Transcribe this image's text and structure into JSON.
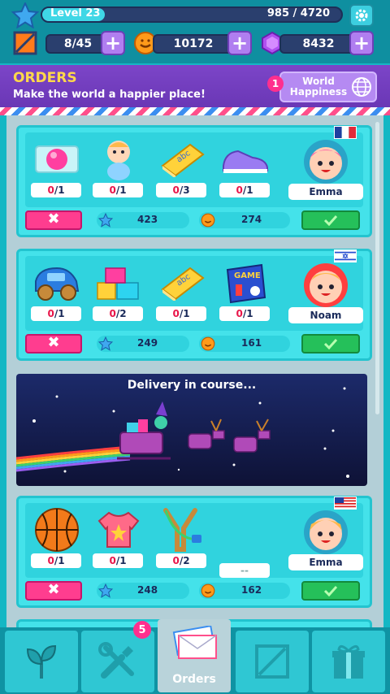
{
  "player": {
    "level_label": "Level 23",
    "xp_text": "985 / 4720",
    "xp_fraction": 0.209
  },
  "resources": {
    "boxes": "8/45",
    "coins": "10172",
    "gems": "8432"
  },
  "orders_header": {
    "title": "ORDERS",
    "subtitle": "Make the world a happier place!",
    "world_happiness_label": "World Happiness",
    "world_happiness_badge": "1"
  },
  "orders": [
    {
      "client": "Emma",
      "flag": "france",
      "items": [
        {
          "icon": "candy-icon",
          "done": "0",
          "total": "/1"
        },
        {
          "icon": "baby-doll-icon",
          "done": "0",
          "total": "/1"
        },
        {
          "icon": "abc-book-icon",
          "done": "0",
          "total": "/3"
        },
        {
          "icon": "sneakers-icon",
          "done": "0",
          "total": "/1"
        }
      ],
      "reward_xp": "423",
      "reward_coins": "274"
    },
    {
      "client": "Noam",
      "flag": "israel",
      "items": [
        {
          "icon": "toy-car-icon",
          "done": "0",
          "total": "/1"
        },
        {
          "icon": "building-blocks-icon",
          "done": "0",
          "total": "/2"
        },
        {
          "icon": "abc-book-icon",
          "done": "0",
          "total": "/1"
        },
        {
          "icon": "board-game-icon",
          "done": "0",
          "total": "/1"
        }
      ],
      "reward_xp": "249",
      "reward_coins": "161"
    },
    {
      "client": "Emma",
      "flag": "usa",
      "items": [
        {
          "icon": "basketball-icon",
          "done": "0",
          "total": "/1"
        },
        {
          "icon": "tshirt-icon",
          "done": "0",
          "total": "/1"
        },
        {
          "icon": "slingshot-icon",
          "done": "0",
          "total": "/2"
        },
        {
          "icon": "empty-slot",
          "done": "--",
          "total": ""
        }
      ],
      "reward_xp": "248",
      "reward_coins": "162"
    }
  ],
  "delivery": {
    "title": "Delivery in course..."
  },
  "nav": {
    "tabs": [
      {
        "icon": "sprout-icon",
        "label": ""
      },
      {
        "icon": "tools-icon",
        "label": ""
      },
      {
        "icon": "letters-icon",
        "label": "Orders"
      },
      {
        "icon": "crate-icon",
        "label": ""
      },
      {
        "icon": "gift-icon",
        "label": ""
      }
    ],
    "tools_badge": "5"
  },
  "colors": {
    "accent_teal": "#44e2ea",
    "purple": "#7c45c8",
    "reject_pink": "#ff3d8f",
    "accept_green": "#25c05a",
    "coin_orange": "#ff9a1a"
  }
}
